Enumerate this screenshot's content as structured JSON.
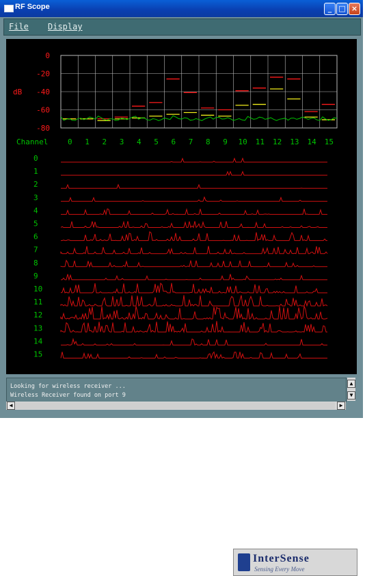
{
  "window": {
    "title": "RF Scope"
  },
  "menu": {
    "file": "File",
    "display": "Display"
  },
  "spectrum": {
    "db_label": "dB",
    "db_ticks": [
      "0",
      "-20",
      "-40",
      "-60",
      "-80"
    ],
    "channel_label": "Channel",
    "channels": [
      "0",
      "1",
      "2",
      "3",
      "4",
      "5",
      "6",
      "7",
      "8",
      "9",
      "10",
      "11",
      "12",
      "13",
      "14",
      "15"
    ],
    "peak_db": [
      -70,
      -70,
      -70,
      -68,
      -56,
      -52,
      -26,
      -41,
      -58,
      -60,
      -39,
      -36,
      -24,
      -26,
      -62,
      -54
    ],
    "yellow_db": [
      -70,
      -70,
      -72,
      -70,
      -69,
      -67,
      -65,
      -63,
      -66,
      -67,
      -55,
      -54,
      -37,
      -48,
      -68,
      -71
    ]
  },
  "waterfall": {
    "rows": [
      "0",
      "1",
      "2",
      "3",
      "4",
      "5",
      "6",
      "7",
      "8",
      "9",
      "10",
      "11",
      "12",
      "13",
      "14",
      "15"
    ],
    "activity": [
      0.05,
      0.02,
      0.02,
      0.1,
      0.25,
      0.35,
      0.55,
      0.45,
      0.3,
      0.25,
      0.7,
      0.85,
      1.0,
      0.8,
      0.3,
      0.3
    ]
  },
  "log": {
    "lines": [
      "Looking for wireless receiver ...",
      "Wireless Receiver found on port 9"
    ]
  },
  "colors": {
    "bg": "#000000",
    "green": "#00c400",
    "red": "#ff1a1a",
    "trace": "#d01010",
    "yellow": "#f2ee1a",
    "grid": "#bdbdbd"
  },
  "logo": {
    "name": "InterSense",
    "tagline": "Sensing Every Move"
  }
}
